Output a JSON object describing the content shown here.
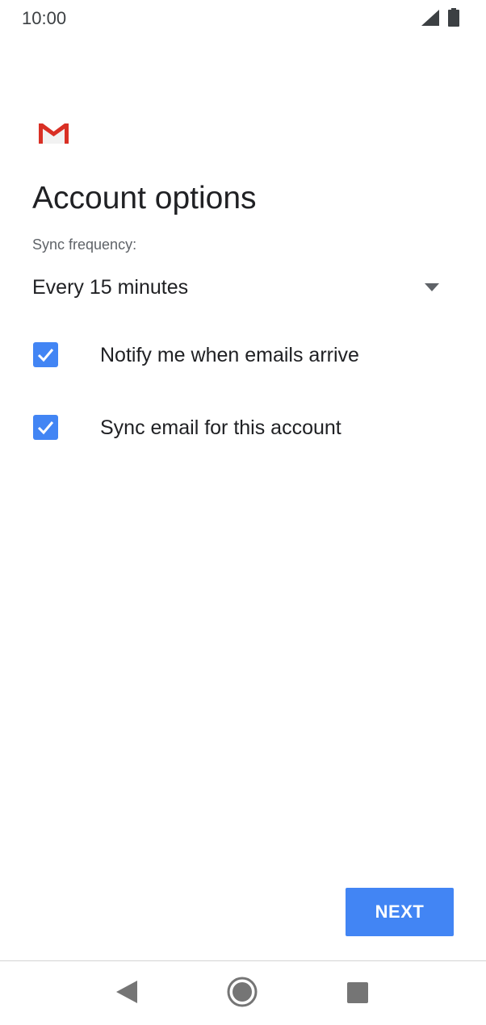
{
  "status_bar": {
    "time": "10:00",
    "icons": [
      "signal-icon",
      "battery-icon"
    ]
  },
  "logo": {
    "name": "gmail-logo-icon"
  },
  "page": {
    "title": "Account options",
    "sync_label": "Sync frequency:",
    "sync_value": "Every 15 minutes",
    "options": [
      {
        "label": "Notify me when emails arrive",
        "checked": true
      },
      {
        "label": "Sync email for this account",
        "checked": true
      }
    ],
    "next_label": "NEXT"
  },
  "nav": {
    "icons": [
      "back-icon",
      "home-icon",
      "recents-icon"
    ]
  },
  "colors": {
    "accent": "#4285f4",
    "gmail_red": "#d93025",
    "text_primary": "#202124",
    "text_secondary": "#5f6368"
  }
}
